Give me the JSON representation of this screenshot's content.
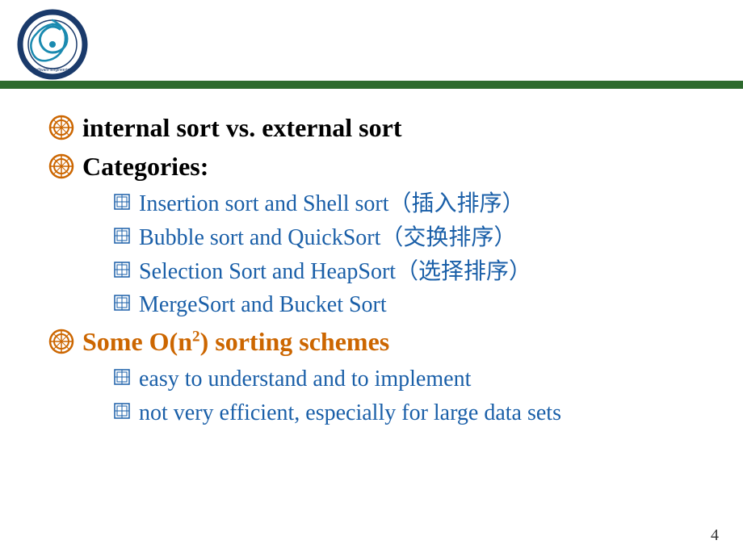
{
  "header": {
    "logo_alt": "University Logo"
  },
  "page_number": "4",
  "content": {
    "l1_items": [
      {
        "id": "internal-sort",
        "text": "internal sort vs. external sort",
        "orange": false
      },
      {
        "id": "categories",
        "text": "Categories:",
        "orange": false
      },
      {
        "id": "some-on2",
        "text": "Some O(n²) sorting schemes",
        "orange": true
      }
    ],
    "categories_sub": [
      {
        "id": "insertion-shell",
        "text": "Insertion sort and Shell sort（插入排序）"
      },
      {
        "id": "bubble-quick",
        "text": "Bubble sort  and QuickSort（交换排序）"
      },
      {
        "id": "selection-heap",
        "text": "Selection Sort and HeapSort（选择排序）"
      },
      {
        "id": "merge-bucket",
        "text": "MergeSort and Bucket Sort"
      }
    ],
    "on2_sub": [
      {
        "id": "easy",
        "text": "easy to understand and to implement"
      },
      {
        "id": "not-efficient",
        "text": "not very efficient, especially for large data sets"
      }
    ]
  }
}
